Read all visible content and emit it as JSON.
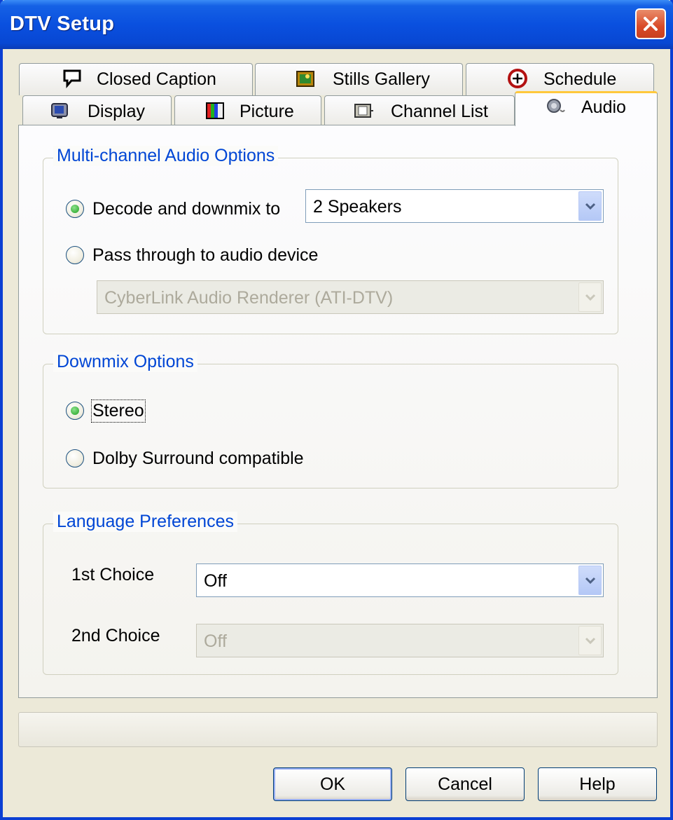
{
  "window": {
    "title": "DTV Setup"
  },
  "tabs_back": [
    {
      "label": "Closed Caption",
      "icon": "speech-bubble-icon"
    },
    {
      "label": "Stills Gallery",
      "icon": "picture-frame-icon"
    },
    {
      "label": "Schedule",
      "icon": "clock-icon"
    }
  ],
  "tabs_front": [
    {
      "label": "Display",
      "icon": "monitor-icon"
    },
    {
      "label": "Picture",
      "icon": "color-bars-icon"
    },
    {
      "label": "Channel List",
      "icon": "film-strip-icon"
    },
    {
      "label": "Audio",
      "icon": "speaker-icon",
      "active": true
    }
  ],
  "multichannel": {
    "legend": "Multi-channel Audio Options",
    "decode_label": "Decode and downmix to",
    "decode_selected": true,
    "speakers_value": "2 Speakers",
    "pass_label": "Pass through to audio device",
    "pass_selected": false,
    "device_value": "CyberLink Audio Renderer (ATI-DTV)"
  },
  "downmix": {
    "legend": "Downmix Options",
    "stereo_label": "Stereo",
    "stereo_selected": true,
    "dolby_label": "Dolby Surround compatible",
    "dolby_selected": false
  },
  "language": {
    "legend": "Language Preferences",
    "first_label": "1st Choice",
    "first_value": "Off",
    "second_label": "2nd Choice",
    "second_value": "Off"
  },
  "buttons": {
    "ok": "OK",
    "cancel": "Cancel",
    "help": "Help"
  },
  "colors": {
    "title_bar": "#0a50df",
    "group_legend": "#0046d5",
    "active_tab_highlight": "#ffc83c"
  }
}
